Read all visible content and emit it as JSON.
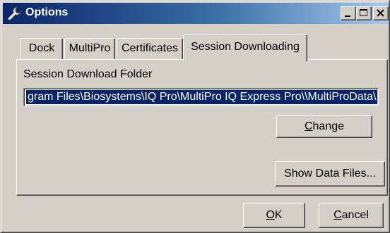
{
  "window": {
    "title": "Options",
    "title_icon": "wrench-icon",
    "controls": [
      "minimize-icon",
      "maximize-icon",
      "close-icon"
    ]
  },
  "tabs": [
    {
      "label": "Dock",
      "active": false
    },
    {
      "label": "MultiPro",
      "active": false
    },
    {
      "label": "Certificates",
      "active": false
    },
    {
      "label": "Session Downloading",
      "active": true
    }
  ],
  "session_tab": {
    "folder_label": "Session Download Folder",
    "folder_value": "gram Files\\Biosystems\\IQ Pro\\MultiPro IQ Express Pro\\\\MultiProData\\",
    "change_button": {
      "mnemonic": "C",
      "rest": "hange"
    },
    "show_data_files_button": "Show Data Files..."
  },
  "footer": {
    "ok_button": {
      "mnemonic": "O",
      "rest": "K"
    },
    "cancel_button": {
      "mnemonic": "C",
      "rest": "ancel"
    }
  },
  "colors": {
    "title_gradient_start": "#0a246a",
    "title_gradient_end": "#a6caf0",
    "face": "#d4d0c8",
    "selection": "#0a246a"
  }
}
